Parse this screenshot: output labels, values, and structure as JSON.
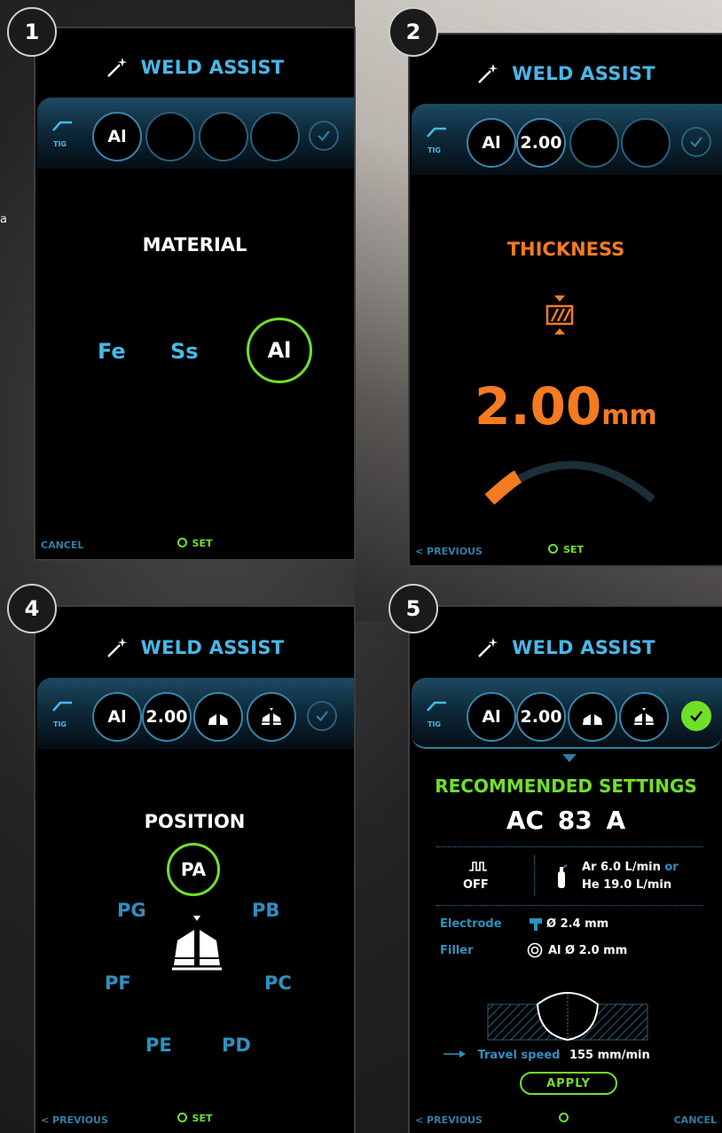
{
  "background": {
    "edge_text": "a"
  },
  "app": {
    "title": "WELD ASSIST",
    "process_label": "TIG"
  },
  "colors": {
    "accent_blue": "#48b8e8",
    "accent_orange": "#f47b20",
    "accent_green": "#6fe02a",
    "panel_bg": "#000000"
  },
  "panels": [
    {
      "step": "1",
      "slots": [
        "Al",
        "",
        "",
        ""
      ],
      "section_title": "MATERIAL",
      "options": [
        "Fe",
        "Ss",
        "Al"
      ],
      "selected": "Al",
      "footer": {
        "left": "CANCEL",
        "center": "SET"
      }
    },
    {
      "step": "2",
      "slots": [
        "Al",
        "2.00",
        "",
        ""
      ],
      "section_title": "THICKNESS",
      "value": "2.00",
      "unit": "mm",
      "level_fraction": 0.08,
      "footer": {
        "left": "< PREVIOUS",
        "center": "SET"
      }
    },
    {
      "step": "4",
      "slots": [
        "Al",
        "2.00",
        "flat-position-icon",
        "vertical-position-icon"
      ],
      "section_title": "POSITION",
      "selected": "PA",
      "positions": [
        "PG",
        "PB",
        "PF",
        "PC",
        "PE",
        "PD"
      ],
      "footer": {
        "left": "< PREVIOUS",
        "center": "SET"
      }
    },
    {
      "step": "5",
      "slots": [
        "Al",
        "2.00",
        "flat-position-icon",
        "vertical-position-icon"
      ],
      "recommended_title": "RECOMMENDED SETTINGS",
      "recommended_value": "AC 83 A",
      "pulse_state": "OFF",
      "gas_line1_a": "Ar 6.0 L/min",
      "gas_line1_or": "or",
      "gas_line2": "He 19.0 L/min",
      "electrode_label": "Electrode",
      "electrode_value": "Ø 2.4 mm",
      "filler_label": "Filler",
      "filler_value": "Al Ø 2.0 mm",
      "travel_label": "Travel speed",
      "travel_value": "155 mm/min",
      "apply_label": "APPLY",
      "footer": {
        "left": "< PREVIOUS",
        "right": "CANCEL"
      }
    }
  ]
}
